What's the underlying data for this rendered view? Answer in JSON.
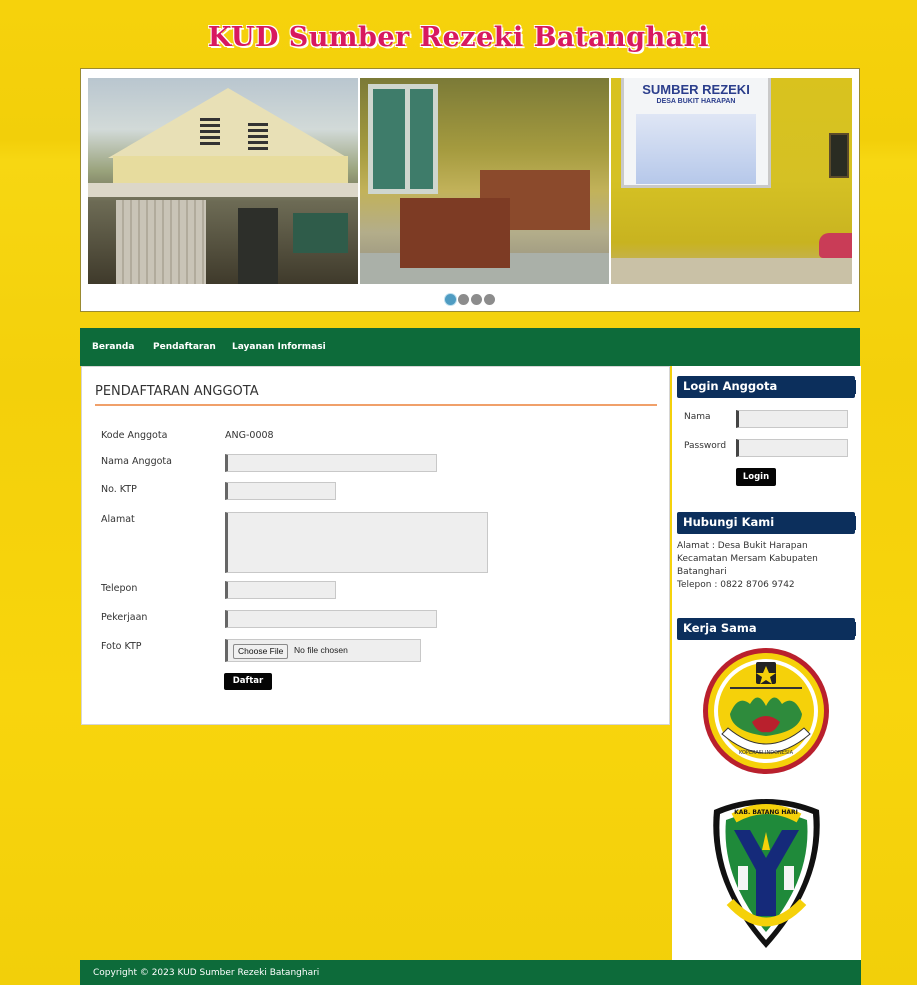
{
  "site": {
    "title": "KUD Sumber Rezeki Batanghari"
  },
  "slider": {
    "images": [
      {
        "name": "house-photo"
      },
      {
        "name": "office-room-photo"
      },
      {
        "name": "organization-board-photo",
        "board_title": "SUMBER REZEKI",
        "board_subtitle": "DESA BUKIT HARAPAN"
      }
    ],
    "dot_count": 4,
    "active_index": 0
  },
  "nav": {
    "items": [
      {
        "label": "Beranda"
      },
      {
        "label": "Pendaftaran"
      },
      {
        "label": "Layanan Informasi"
      }
    ]
  },
  "main": {
    "title": "PENDAFTARAN ANGGOTA",
    "form": {
      "kode_label": "Kode Anggota",
      "kode_value": "ANG-0008",
      "nama_label": "Nama Anggota",
      "ktp_label": "No. KTP",
      "alamat_label": "Alamat",
      "telepon_label": "Telepon",
      "pekerjaan_label": "Pekerjaan",
      "foto_label": "Foto KTP",
      "file_button": "Choose File",
      "file_status": "No file chosen",
      "submit_label": "Daftar"
    }
  },
  "sidebar": {
    "login": {
      "heading": "Login Anggota",
      "nama_label": "Nama",
      "password_label": "Password",
      "button_label": "Login"
    },
    "contact": {
      "heading": "Hubungi Kami",
      "address": "Alamat : Desa Bukit Harapan Kecamatan Mersam Kabupaten Batanghari",
      "phone": "Telepon : 0822 8706 9742"
    },
    "partners": {
      "heading": "Kerja Sama",
      "logos": [
        {
          "icon": "koperasi-indonesia-logo",
          "text": "KOPERASI INDONESIA"
        },
        {
          "icon": "kabupaten-batanghari-logo",
          "text": "KAB. BATANG HARI"
        }
      ]
    }
  },
  "footer": {
    "text": "Copyright © 2023 KUD Sumber Rezeki Batanghari"
  },
  "colors": {
    "background": "#f6d20c",
    "nav": "#0d6b3a",
    "sidebar_heading": "#0c2f5c",
    "title": "#d8195f",
    "title_underline": "#f0a06a"
  }
}
